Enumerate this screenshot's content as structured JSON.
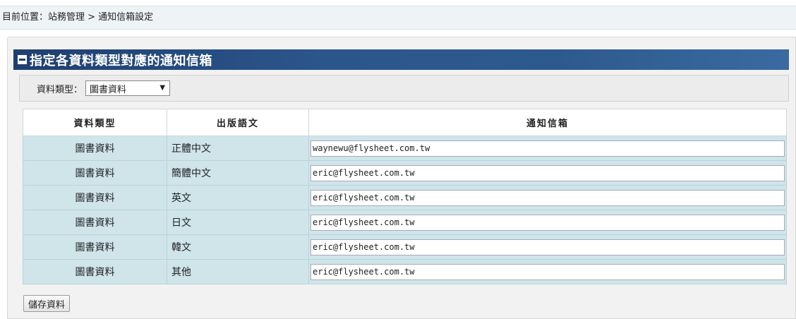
{
  "breadcrumb": "目前位置：站務管理 > 通知信箱設定",
  "section": {
    "title": "指定各資料類型對應的通知信箱"
  },
  "filter": {
    "label": "資料類型：",
    "selected": "圖書資料"
  },
  "table": {
    "headers": [
      "資料類型",
      "出版語文",
      "通知信箱"
    ],
    "rows": [
      {
        "type": "圖書資料",
        "lang": "正體中文",
        "email": "waynewu@flysheet.com.tw"
      },
      {
        "type": "圖書資料",
        "lang": "簡體中文",
        "email": "eric@flysheet.com.tw"
      },
      {
        "type": "圖書資料",
        "lang": "英文",
        "email": "eric@flysheet.com.tw"
      },
      {
        "type": "圖書資料",
        "lang": "日文",
        "email": "eric@flysheet.com.tw"
      },
      {
        "type": "圖書資料",
        "lang": "韓文",
        "email": "eric@flysheet.com.tw"
      },
      {
        "type": "圖書資料",
        "lang": "其他",
        "email": "eric@flysheet.com.tw"
      }
    ]
  },
  "actions": {
    "save_label": "儲存資料"
  }
}
